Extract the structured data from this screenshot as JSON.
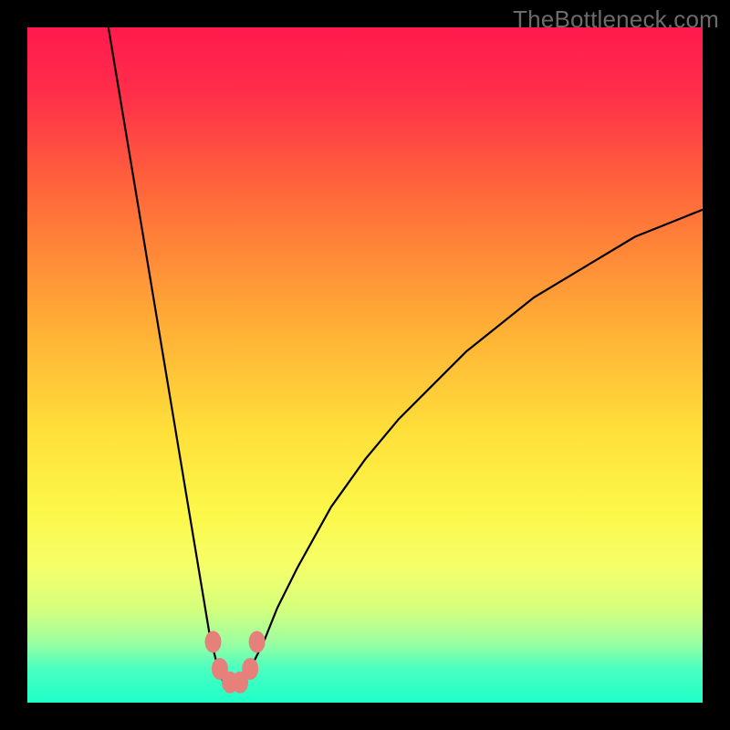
{
  "watermark": "TheBottleneck.com",
  "chart_data": {
    "type": "line",
    "title": "",
    "xlabel": "",
    "ylabel": "",
    "xlim": [
      0,
      100
    ],
    "ylim": [
      0,
      100
    ],
    "grid": false,
    "series": [
      {
        "name": "curve",
        "x": [
          12,
          13,
          14,
          15,
          16,
          17,
          18,
          19,
          20,
          21,
          22,
          23,
          24,
          25,
          26,
          27,
          28,
          29,
          30,
          31,
          32,
          33,
          35,
          37,
          40,
          45,
          50,
          55,
          60,
          65,
          70,
          75,
          80,
          85,
          90,
          95,
          100
        ],
        "y": [
          100,
          94,
          88,
          82,
          76,
          70,
          64,
          58,
          52,
          46,
          40,
          34,
          28,
          22,
          16,
          10,
          6,
          3,
          2,
          2,
          3,
          5,
          9,
          14,
          20,
          29,
          36,
          42,
          47,
          52,
          56,
          60,
          63,
          66,
          69,
          71,
          73
        ]
      }
    ],
    "markers": {
      "name": "highlight-dots",
      "color": "#e5807b",
      "points": [
        {
          "x": 27.5,
          "y": 9
        },
        {
          "x": 28.5,
          "y": 5
        },
        {
          "x": 30.0,
          "y": 3
        },
        {
          "x": 31.5,
          "y": 3
        },
        {
          "x": 33.0,
          "y": 5
        },
        {
          "x": 34.0,
          "y": 9
        }
      ]
    },
    "background_gradient": {
      "stops": [
        {
          "offset": 0.0,
          "color": "#ff1a4d"
        },
        {
          "offset": 0.1,
          "color": "#ff2f4a"
        },
        {
          "offset": 0.25,
          "color": "#ff6a3a"
        },
        {
          "offset": 0.45,
          "color": "#ffb136"
        },
        {
          "offset": 0.6,
          "color": "#ffe03a"
        },
        {
          "offset": 0.72,
          "color": "#fcf84a"
        },
        {
          "offset": 0.8,
          "color": "#f5ff6a"
        },
        {
          "offset": 0.86,
          "color": "#d6ff7c"
        },
        {
          "offset": 0.91,
          "color": "#9dffa0"
        },
        {
          "offset": 0.95,
          "color": "#4affc0"
        },
        {
          "offset": 1.0,
          "color": "#1effc8"
        }
      ]
    }
  }
}
